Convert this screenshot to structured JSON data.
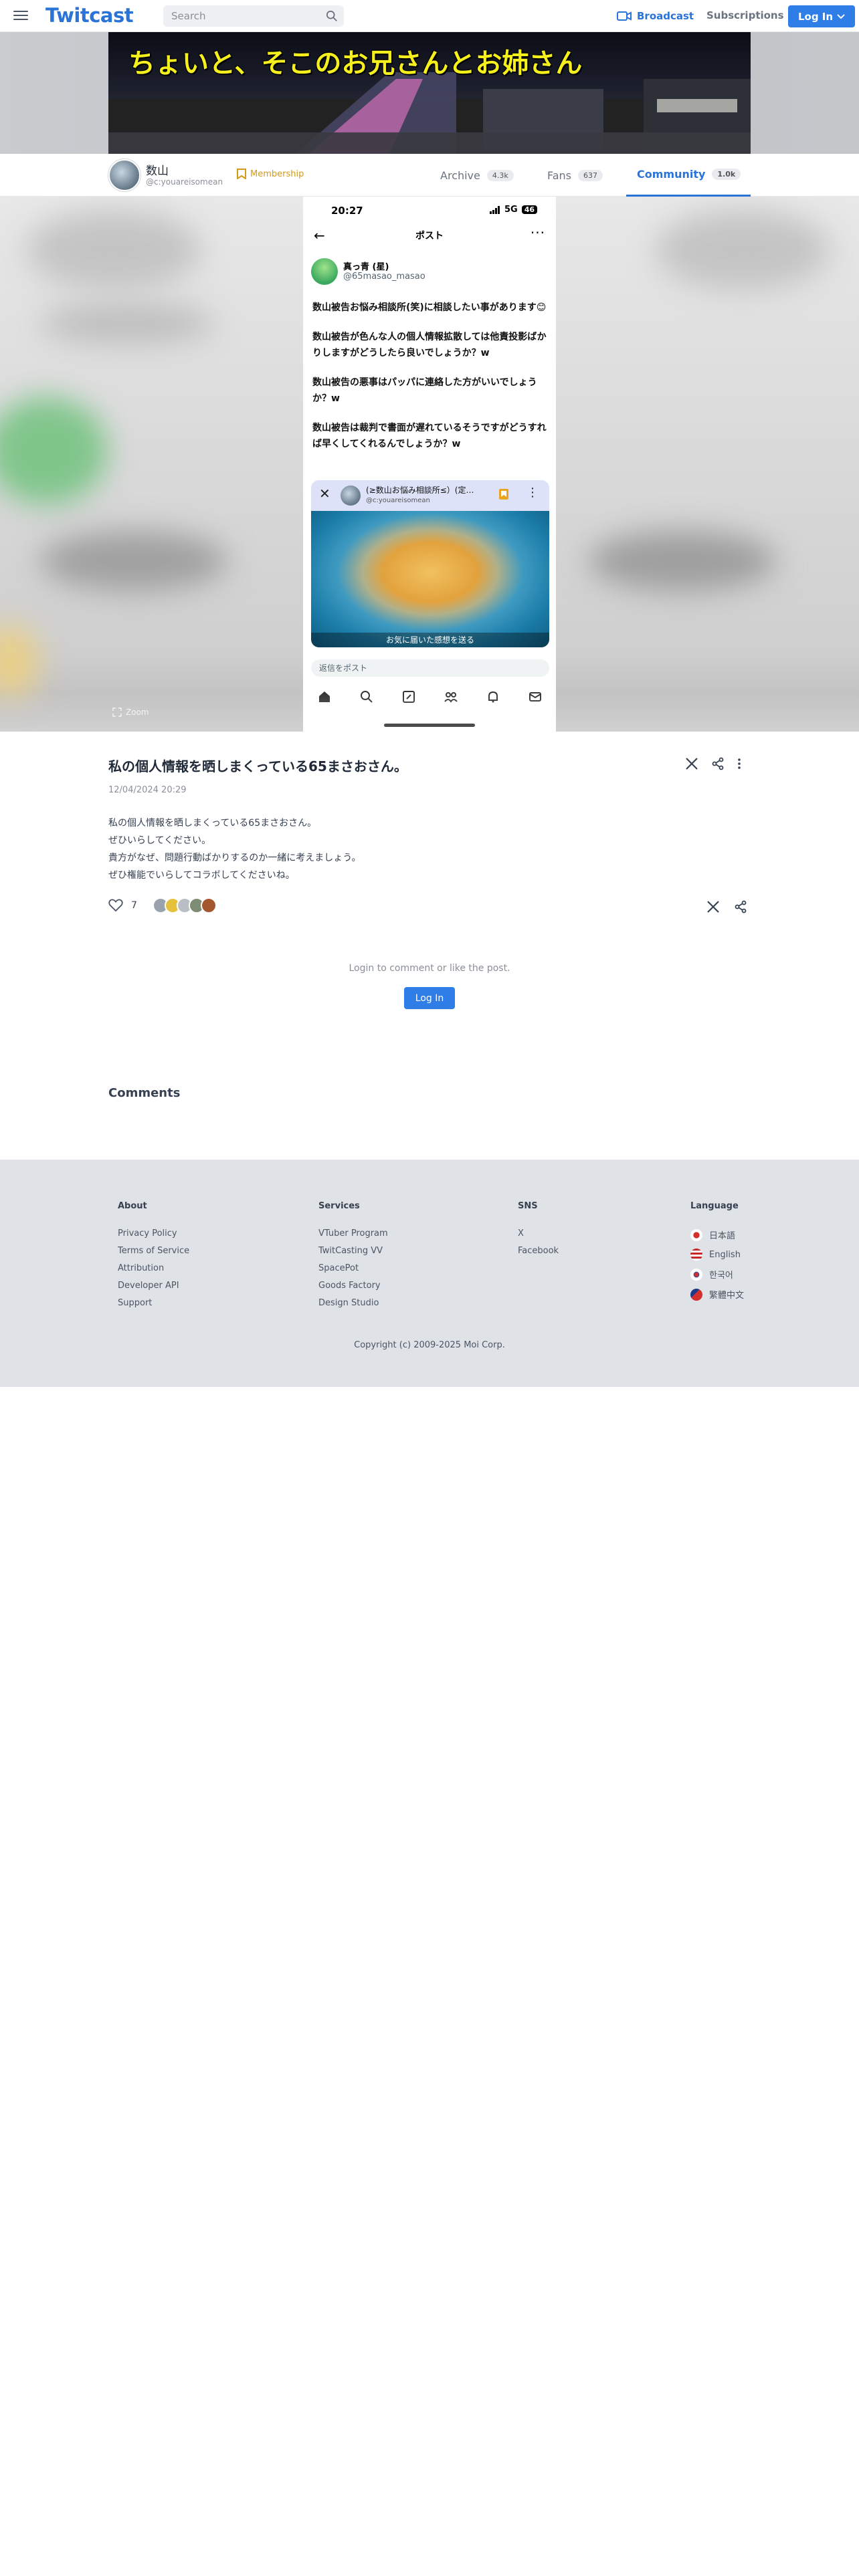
{
  "header": {
    "logo": "Twitcast",
    "search_placeholder": "Search",
    "broadcast_label": "Broadcast",
    "subscriptions_label": "Subscriptions",
    "login_label": "Log In"
  },
  "banner": {
    "title": "ちょいと、そこのお兄さんとお姉さん"
  },
  "profile": {
    "name": "数山",
    "handle": "@c:youareisomean",
    "membership_label": "Membership",
    "tabs": [
      {
        "label": "Archive",
        "count": "4.3k"
      },
      {
        "label": "Fans",
        "count": "637"
      },
      {
        "label": "Community",
        "count": "1.0k",
        "active": true
      }
    ]
  },
  "screenshot": {
    "status_time": "20:27",
    "status_network": "5G",
    "status_battery": "46",
    "nav_title": "ポスト",
    "user_name": "真っ青 (星)",
    "user_handle": "@65masao_masao",
    "paragraphs": [
      "数山被告お悩み相談所(笑)に相談したい事があります😊",
      "数山被告が色んな人の個人情報拡散しては他責投影ばかりしますがどうしたら良いでしょうか？w",
      "数山被告の悪事はパッパに連絡した方がいいでしょうか？w",
      "数山被告は裁判で書面が遅れているそうですがどうすれば早くしてくれるんでしょうか？w"
    ],
    "card_title": "(≥数山お悩み相談所≤）(定…",
    "card_handle": "@c:youareisomean",
    "card_caption": "お気に届いた感想を送る",
    "reply_placeholder": "返信をポスト",
    "zoom_label": "Zoom"
  },
  "post": {
    "title": "私の個人情報を晒しまくっている65まさおさん。",
    "date": "12/04/2024 20:29",
    "body": [
      "私の個人情報を晒しまくっている65まさおさん。",
      "ぜひいらしてください。",
      "貴方がなぜ、問題行動ばかりするのか一緒に考えましょう。",
      "ぜひ権能でいらしてコラボしてくださいね。"
    ],
    "like_count": "7"
  },
  "login_prompt": {
    "message": "Login to comment or like the post.",
    "button": "Log In"
  },
  "comments_heading": "Comments",
  "footer": {
    "about": {
      "heading": "About",
      "links": [
        "Privacy Policy",
        "Terms of Service",
        "Attribution",
        "Developer API",
        "Support"
      ]
    },
    "services": {
      "heading": "Services",
      "links": [
        "VTuber Program",
        "TwitCasting VV",
        "SpacePot",
        "Goods Factory",
        "Design Studio"
      ]
    },
    "sns": {
      "heading": "SNS",
      "links": [
        "X",
        "Facebook"
      ]
    },
    "language": {
      "heading": "Language",
      "links": [
        "日本語",
        "English",
        "한국어",
        "繁體中文"
      ]
    },
    "copyright": "Copyright (c) 2009-2025 Moi Corp."
  },
  "colors": {
    "brand_blue": "#2a74d8",
    "membership_gold": "#d49a1a",
    "banner_text": "#f5ef1e",
    "footer_bg": "#dfe2e6"
  }
}
